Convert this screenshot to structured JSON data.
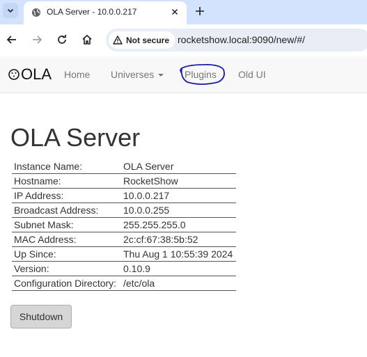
{
  "browser": {
    "tab": {
      "title": "OLA Server - 10.0.0.217",
      "favicon": "globe-icon"
    },
    "security_label": "Not secure",
    "url": "rocketshow.local:9090/new/#/"
  },
  "navbar": {
    "logo_text": "OLA",
    "links": {
      "home": "Home",
      "universes": "Universes",
      "plugins": "Plugins",
      "old_ui": "Old UI"
    },
    "annotation_color": "#1a1aa6"
  },
  "main": {
    "title": "OLA Server",
    "info": [
      {
        "key": "Instance Name:",
        "value": "OLA Server"
      },
      {
        "key": "Hostname:",
        "value": "RocketShow"
      },
      {
        "key": "IP Address:",
        "value": "10.0.0.217"
      },
      {
        "key": "Broadcast Address:",
        "value": "10.0.0.255"
      },
      {
        "key": "Subnet Mask:",
        "value": "255.255.255.0"
      },
      {
        "key": "MAC Address:",
        "value": "2c:cf:67:38:5b:52"
      },
      {
        "key": "Up Since:",
        "value": "Thu Aug 1 10:55:39 2024"
      },
      {
        "key": "Version:",
        "value": "0.10.9"
      },
      {
        "key": "Configuration Directory:",
        "value": "/etc/ola"
      }
    ],
    "shutdown_label": "Shutdown"
  }
}
